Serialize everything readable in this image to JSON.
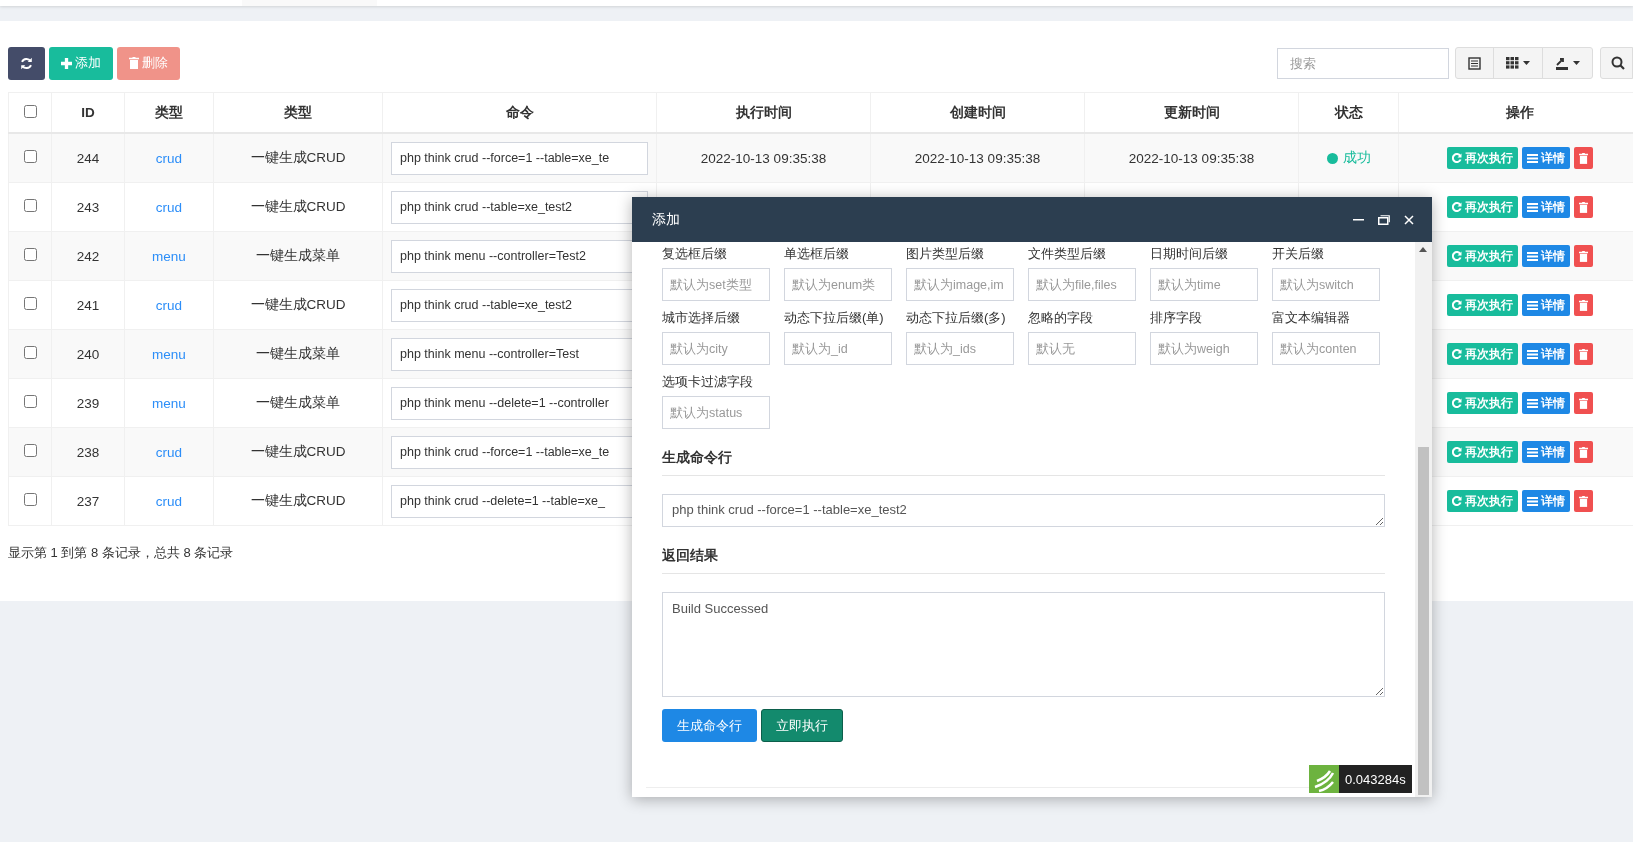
{
  "toolbar": {
    "buttons": [
      {
        "kind": "refresh",
        "disabled": false
      },
      {
        "kind": "add",
        "label": "添加",
        "disabled": false
      },
      {
        "kind": "delete",
        "label": "删除",
        "disabled": true
      }
    ],
    "search": {
      "placeholder": "搜索"
    }
  },
  "table": {
    "header_checked": false,
    "columns": [
      "ID",
      "类型",
      "类型",
      "命令",
      "执行时间",
      "创建时间",
      "更新时间",
      "状态",
      "操作"
    ],
    "rows": [
      {
        "checked": false,
        "id": "244",
        "type": "crud",
        "type_name": "一键生成CRUD",
        "command": "php think crud --force=1 --table=xe_te",
        "executed": "2022-10-13 09:35:38",
        "created": "2022-10-13 09:35:38",
        "updated": "2022-10-13 09:35:38",
        "status": "成功",
        "actions": [
          "再次执行",
          "详情"
        ]
      },
      {
        "checked": false,
        "id": "243",
        "type": "crud",
        "type_name": "一键生成CRUD",
        "command": "php think crud --table=xe_test2",
        "actions": [
          "再次执行",
          "详情"
        ]
      },
      {
        "checked": false,
        "id": "242",
        "type": "menu",
        "type_name": "一键生成菜单",
        "command": "php think menu --controller=Test2",
        "actions": [
          "再次执行",
          "详情"
        ]
      },
      {
        "checked": false,
        "id": "241",
        "type": "crud",
        "type_name": "一键生成CRUD",
        "command": "php think crud --table=xe_test2",
        "actions": [
          "再次执行",
          "详情"
        ]
      },
      {
        "checked": false,
        "id": "240",
        "type": "menu",
        "type_name": "一键生成菜单",
        "command": "php think menu --controller=Test",
        "actions": [
          "再次执行",
          "详情"
        ]
      },
      {
        "checked": false,
        "id": "239",
        "type": "menu",
        "type_name": "一键生成菜单",
        "command": "php think menu --delete=1 --controller",
        "actions": [
          "再次执行",
          "详情"
        ]
      },
      {
        "checked": false,
        "id": "238",
        "type": "crud",
        "type_name": "一键生成CRUD",
        "command": "php think crud --force=1 --table=xe_te",
        "actions": [
          "再次执行",
          "详情"
        ]
      },
      {
        "checked": false,
        "id": "237",
        "type": "crud",
        "type_name": "一键生成CRUD",
        "command": "php think crud --delete=1 --table=xe_",
        "actions": [
          "再次执行",
          "详情"
        ]
      }
    ],
    "footer": "显示第 1 到第 8 条记录，总共 8 条记录"
  },
  "modal": {
    "title": "添加",
    "fields": [
      {
        "label": "复选框后缀",
        "placeholder": "默认为set类型"
      },
      {
        "label": "单选框后缀",
        "placeholder": "默认为enum类"
      },
      {
        "label": "图片类型后缀",
        "placeholder": "默认为image,im"
      },
      {
        "label": "文件类型后缀",
        "placeholder": "默认为file,files"
      },
      {
        "label": "日期时间后缀",
        "placeholder": "默认为time"
      },
      {
        "label": "开关后缀",
        "placeholder": "默认为switch"
      },
      {
        "label": "城市选择后缀",
        "placeholder": "默认为city"
      },
      {
        "label": "动态下拉后缀(单)",
        "placeholder": "默认为_id"
      },
      {
        "label": "动态下拉后缀(多)",
        "placeholder": "默认为_ids"
      },
      {
        "label": "忽略的字段",
        "placeholder": "默认无"
      },
      {
        "label": "排序字段",
        "placeholder": "默认为weigh"
      },
      {
        "label": "富文本编辑器",
        "placeholder": "默认为conten"
      },
      {
        "label": "选项卡过滤字段",
        "placeholder": "默认为status"
      }
    ],
    "sections": [
      {
        "heading": "生成命令行",
        "value": "php think crud --force=1 --table=xe_test2",
        "kind": "short"
      },
      {
        "heading": "返回结果",
        "value": "Build Successed",
        "kind": "tall"
      }
    ],
    "buttons": [
      {
        "label": "生成命令行",
        "kind": "primary"
      },
      {
        "label": "立即执行",
        "kind": "success"
      }
    ]
  },
  "debug_badge": {
    "time": "0.043284s"
  }
}
